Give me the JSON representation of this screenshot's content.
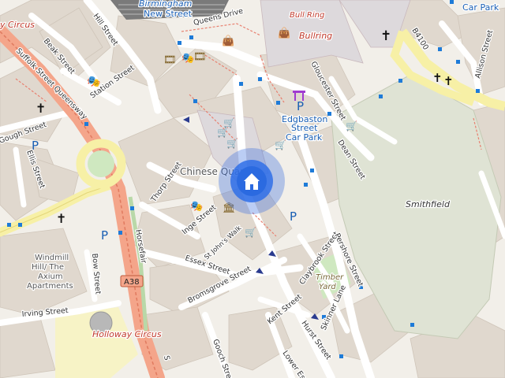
{
  "labels": {
    "birmingham_new_street": "Birmingham",
    "birmingham_new_street_2": "New Street",
    "queens_drive": "Queens Drive",
    "bull_ring": "Bull Ring",
    "bullring": "Bullring",
    "b4100": "B4100",
    "st_martins_car_park": "Car Park",
    "hill_street": "Hill Street",
    "beak_street": "Beak Street",
    "station_street": "Station Street",
    "suffolk_street_queensway": "Suffolk Street Queensway",
    "gough_street": "Gough Street",
    "ellis_street": "Ellis Street",
    "holliday_circus_top": "y Circus",
    "gloucester_street": "Gloucester Street",
    "edgbaston_street_1": "Edgbaston",
    "edgbaston_street_2": "Street",
    "car_park": "Car Park",
    "dean_street": "Dean Street",
    "allison_street": "Allison Street",
    "chinese_quarter": "Chinese Quarter",
    "thorp_street": "Thorp Street",
    "inge_street": "Inge Street",
    "smithfield": "Smithfield",
    "st_johns_walk": "St John's Walk",
    "horsefair": "Horsefair",
    "windmill_1": "Windmill",
    "windmill_2": "Hill/ The",
    "windmill_3": "Axium",
    "windmill_4": "Apartments",
    "bow_street": "Bow Street",
    "essex_street": "Essex Street",
    "claybrook_street": "Claybrook Street",
    "timber_yard_1": "Timber",
    "timber_yard_2": "Yard",
    "pershore_street": "Pershore Street",
    "a38": "A38",
    "bromsgrove_street": "Bromsgrove Street",
    "irving_street": "Irving Street",
    "holloway_circus": "Holloway Circus",
    "kent_street": "Kent Street",
    "skinner_lane": "Skinner Lane",
    "gooch_street": "Gooch Street",
    "lower_essex": "Lower Ess",
    "hurst_street": "Hurst Street",
    "bristol_street_frag": "S",
    "parking_p": "P"
  },
  "marker": {
    "icon": "home-icon",
    "color": "#3b6fe0"
  }
}
